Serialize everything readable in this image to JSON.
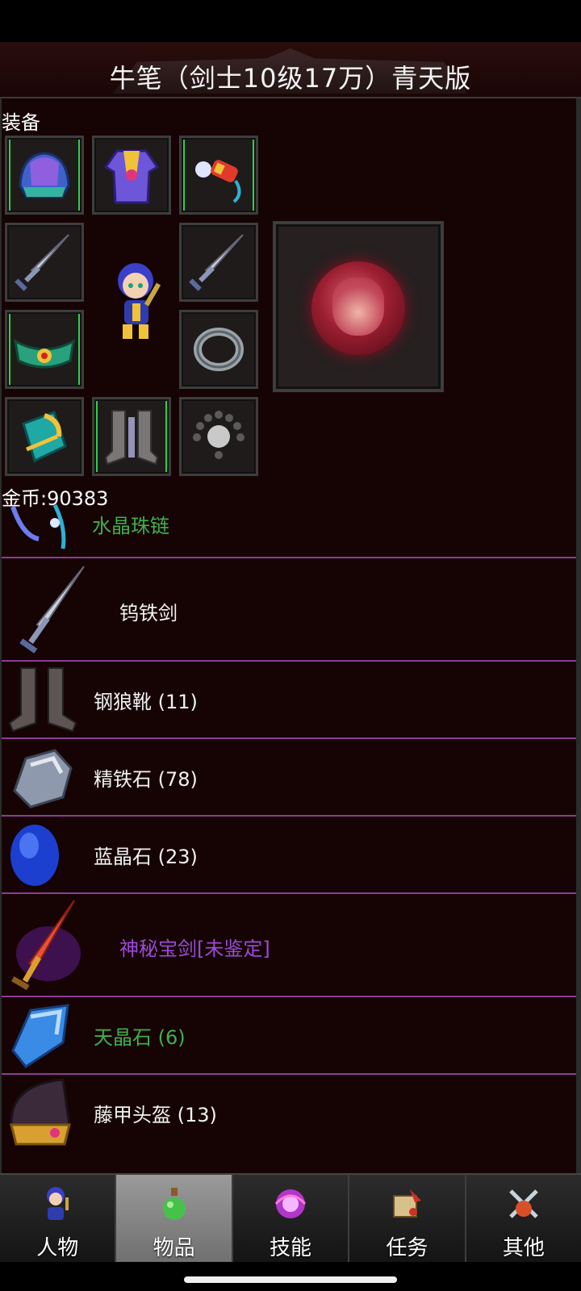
{
  "title": "牛笔（剑士10级17万）青天版",
  "equipment": {
    "section_label": "装备",
    "slots": [
      {
        "icon": "helmet-icon"
      },
      {
        "icon": "robe-armor-icon"
      },
      {
        "icon": "tassel-charm-icon"
      },
      {
        "icon": "sword-icon"
      },
      {
        "icon": "sword-icon"
      },
      {
        "icon": "belt-icon"
      },
      {
        "icon": "ring-icon"
      },
      {
        "icon": "bracer-icon"
      },
      {
        "icon": "boots-icon"
      },
      {
        "icon": "bead-necklace-icon"
      }
    ],
    "gem_icon": "tiger-emblem-icon"
  },
  "gold": {
    "label": "金币:90383"
  },
  "inventory": [
    {
      "name": "水晶珠链",
      "color": "#3fb04b",
      "icon": "crystal-necklace-icon"
    },
    {
      "name": "钨铁剑",
      "color": "#f2f2f2",
      "icon": "sword-icon"
    },
    {
      "name": "钢狼靴 (11)",
      "color": "#f2f2f2",
      "icon": "boots-icon"
    },
    {
      "name": "精铁石 (78)",
      "color": "#f2f2f2",
      "icon": "iron-ore-icon"
    },
    {
      "name": "蓝晶石 (23)",
      "color": "#f2f2f2",
      "icon": "blue-gem-icon"
    },
    {
      "name": "神秘宝剑[未鉴定]",
      "color": "#9b4ad9",
      "icon": "fire-sword-icon"
    },
    {
      "name": "天晶石 (6)",
      "color": "#3fb04b",
      "icon": "sky-crystal-icon"
    },
    {
      "name": "藤甲头盔 (13)",
      "color": "#f2f2f2",
      "icon": "vine-helmet-icon"
    }
  ],
  "tabs": [
    {
      "label": "人物",
      "icon": "character-icon",
      "active": false
    },
    {
      "label": "物品",
      "icon": "potion-icon",
      "active": true
    },
    {
      "label": "技能",
      "icon": "skill-orb-icon",
      "active": false
    },
    {
      "label": "任务",
      "icon": "quest-scroll-icon",
      "active": false
    },
    {
      "label": "其他",
      "icon": "crossed-swords-icon",
      "active": false
    }
  ]
}
